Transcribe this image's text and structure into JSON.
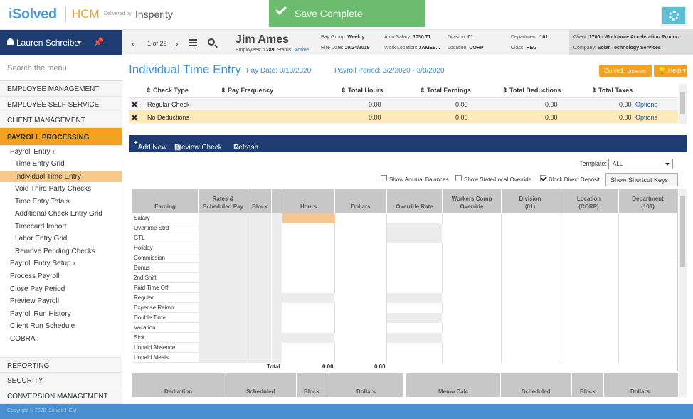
{
  "brand": {
    "logo": "iSolved",
    "product": "HCM",
    "delivered_by": "Delivered by",
    "partner": "Insperity"
  },
  "toast": {
    "message": "Save Complete"
  },
  "user": {
    "name": "Lauren Schreiber"
  },
  "employee": {
    "pager": "1 of 29",
    "name": "Jim Ames",
    "employee_label": "Employee#:",
    "employee_number": "1289",
    "status_label": "Status:",
    "status": "Active",
    "pay_group_label": "Pay Group:",
    "pay_group": "Weekly",
    "hire_date_label": "Hire Date:",
    "hire_date": "10/24/2019",
    "auto_salary_label": "Auto Salary:",
    "auto_salary": "1050.71",
    "work_location_label": "Work Location:",
    "work_location": "JAMES...",
    "division_label": "Division:",
    "division": "01",
    "location_label": "Location:",
    "location": "CORP",
    "department_label": "Department:",
    "department": "101",
    "class_label": "Class:",
    "class": "REG",
    "client_label": "Client:",
    "client": "1700 - Workforce Acceleration Produc...",
    "company_label": "Company:",
    "company": "Solar Technology Services"
  },
  "sidebar": {
    "search_placeholder": "Search the menu",
    "sections": [
      {
        "label": "EMPLOYEE MANAGEMENT"
      },
      {
        "label": "EMPLOYEE SELF SERVICE"
      },
      {
        "label": "CLIENT MANAGEMENT"
      },
      {
        "label": "PAYROLL PROCESSING"
      }
    ],
    "payroll_items": [
      {
        "label": "Payroll Entry  ‹"
      },
      {
        "label": "Time Entry Grid"
      },
      {
        "label": "Individual Time Entry"
      },
      {
        "label": "Void Third Party Checks"
      },
      {
        "label": "Time Entry Totals"
      },
      {
        "label": "Additional Check Entry Grid"
      },
      {
        "label": "Timecard Import"
      },
      {
        "label": "Labor Entry Grid"
      },
      {
        "label": "Remove Pending Checks"
      },
      {
        "label": "Payroll Entry Setup  ›"
      },
      {
        "label": "Process Payroll"
      },
      {
        "label": "Close Pay Period"
      },
      {
        "label": "Preview Payroll"
      },
      {
        "label": "Payroll Run History"
      },
      {
        "label": "Client Run Schedule"
      },
      {
        "label": "COBRA  ›"
      }
    ],
    "bottom_sections": [
      {
        "label": "REPORTING"
      },
      {
        "label": "SECURITY"
      },
      {
        "label": "CONVERSION MANAGEMENT"
      }
    ]
  },
  "page": {
    "title": "Individual Time Entry",
    "pay_date": "Pay Date: 3/13/2020",
    "payroll_period": "Payroll Period: 3/2/2020 - 3/8/2020",
    "university_label": "iSolved",
    "university_sub": "University",
    "help_label": "Help"
  },
  "checks": {
    "headers": [
      "Check Type",
      "Pay Frequency",
      "Total Hours",
      "Total Earnings",
      "Total Deductions",
      "Total Taxes"
    ],
    "rows": [
      {
        "type": "Regular Check",
        "freq": "",
        "hours": "0.00",
        "earnings": "0.00",
        "deductions": "0.00",
        "taxes": "0.00",
        "options": "Options"
      },
      {
        "type": "No Deductions",
        "freq": "",
        "hours": "0.00",
        "earnings": "0.00",
        "deductions": "0.00",
        "taxes": "0.00",
        "options": "Options"
      }
    ]
  },
  "toolbar": {
    "add_new": "Add New",
    "preview_check": "Preview Check",
    "refresh": "Refresh"
  },
  "options": {
    "template_label": "Template:",
    "template_value": "ALL",
    "show_accrual": "Show Accrual Balances",
    "show_state_local": "Show State/Local Override",
    "block_direct_deposit": "Block Direct Deposit",
    "shortcut_keys": "Show Shortcut Keys"
  },
  "earnings": {
    "headers": [
      "Earning",
      "Rates & Scheduled Pay",
      "Block",
      "",
      "Hours",
      "Dollars",
      "Override Rate",
      "Workers Comp Override",
      "Division (01)",
      "Location (CORP)",
      "Department (101)"
    ],
    "header_line1": [
      "",
      "Rates &",
      "",
      "",
      "",
      "",
      "",
      "Workers Comp",
      "Division",
      "Location",
      "Department"
    ],
    "header_line2": [
      "Earning",
      "Scheduled Pay",
      "Block",
      "",
      "Hours",
      "Dollars",
      "Override Rate",
      "Override",
      "(01)",
      "(CORP)",
      "(101)"
    ],
    "rows": [
      "Salary",
      "Overtime Strd",
      "GTL",
      "Holiday",
      "Commission",
      "Bonus",
      "2nd Shift",
      "Paid Time Off",
      "Regular",
      "Expense Reimb",
      "Double Time",
      "Vacation",
      "Sick",
      "Unpaid Absence",
      "Unpaid Meals"
    ],
    "total_label": "Total",
    "total_hours": "0.00",
    "total_dollars": "0.00"
  },
  "deductions": {
    "headers": [
      "Deduction",
      "Scheduled",
      "Block",
      "Dollars"
    ]
  },
  "memo": {
    "headers": [
      "Memo Calc",
      "Scheduled",
      "Block",
      "Dollars"
    ]
  },
  "footer": {
    "copyright": "Copyright © 2020 iSolved HCM"
  },
  "colors": {
    "navy": "#1e3c72",
    "orange": "#f4a11f",
    "blue_text": "#3b8ed0",
    "toast_green": "#6cbb6f",
    "footer_blue": "#4a90d0"
  }
}
